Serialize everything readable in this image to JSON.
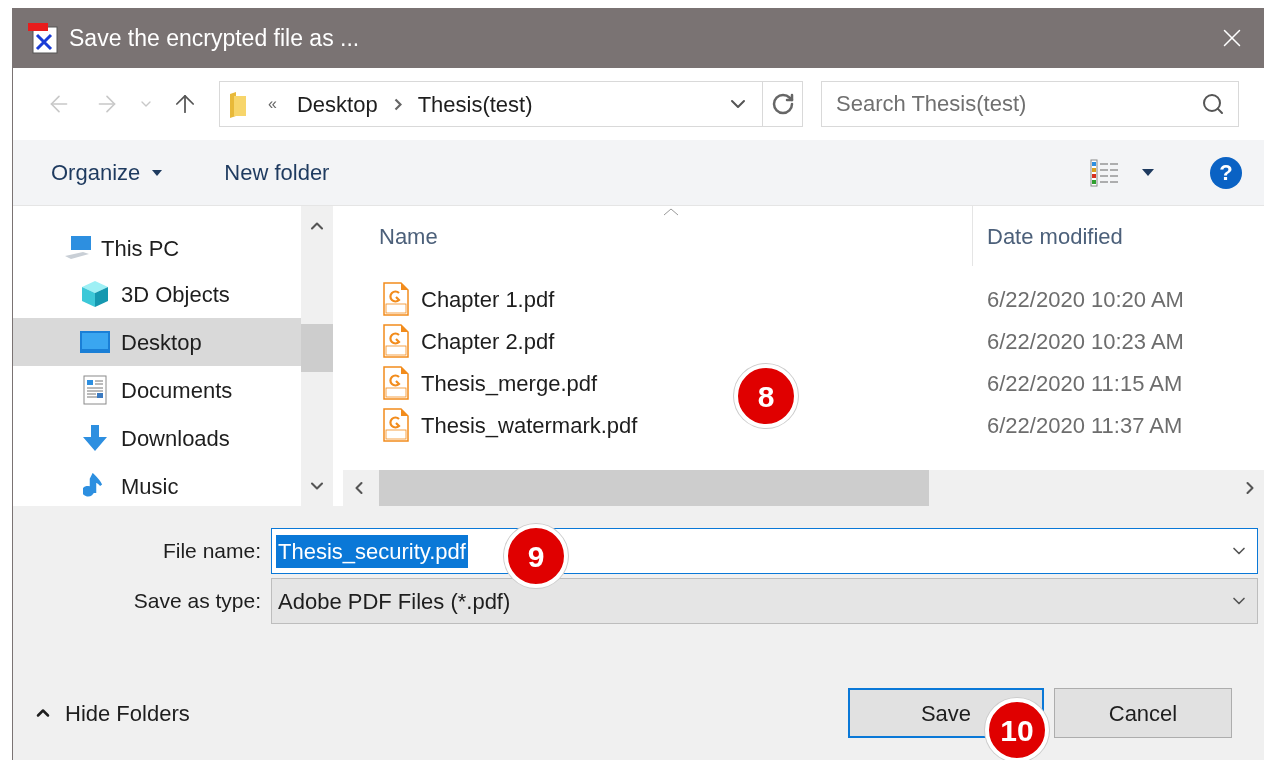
{
  "window": {
    "title": "Save the encrypted file as ..."
  },
  "nav_buttons": [
    {
      "kind": "back",
      "disabled": true
    },
    {
      "kind": "forward",
      "disabled": true
    },
    {
      "kind": "recent",
      "disabled": true
    },
    {
      "kind": "up",
      "disabled": false
    }
  ],
  "address": {
    "overflow": "«",
    "crumbs": [
      "Desktop",
      "Thesis(test)"
    ]
  },
  "search": {
    "placeholder": "Search Thesis(test)"
  },
  "toolbar": {
    "organize": "Organize",
    "new_folder": "New folder",
    "help": "?"
  },
  "sidebar": {
    "items": [
      {
        "label": "This PC",
        "kind": "pc",
        "selected": false,
        "children": [
          {
            "label": "3D Objects",
            "kind": "cube",
            "selected": false
          },
          {
            "label": "Desktop",
            "kind": "desktop",
            "selected": true
          },
          {
            "label": "Documents",
            "kind": "document",
            "selected": false
          },
          {
            "label": "Downloads",
            "kind": "download",
            "selected": false
          },
          {
            "label": "Music",
            "kind": "music",
            "selected": false
          }
        ]
      }
    ]
  },
  "files": {
    "columns": [
      "Name",
      "Date modified"
    ],
    "rows": [
      {
        "name": "Chapter 1.pdf",
        "date": "6/22/2020 10:20 AM"
      },
      {
        "name": "Chapter 2.pdf",
        "date": "6/22/2020 10:23 AM"
      },
      {
        "name": "Thesis_merge.pdf",
        "date": "6/22/2020 11:15 AM"
      },
      {
        "name": "Thesis_watermark.pdf",
        "date": "6/22/2020 11:37 AM"
      }
    ]
  },
  "form": {
    "file_name": {
      "label": "File name:",
      "value": "Thesis_security.pdf",
      "value_selected": true
    },
    "save_as_type": {
      "label": "Save as type:",
      "value": "Adobe PDF Files (*.pdf)"
    }
  },
  "hide_folders": "Hide Folders",
  "buttons": [
    {
      "label": "Save",
      "kind": "default"
    },
    {
      "label": "Cancel",
      "kind": "normal"
    }
  ],
  "callouts": [
    "8",
    "9",
    "10"
  ]
}
